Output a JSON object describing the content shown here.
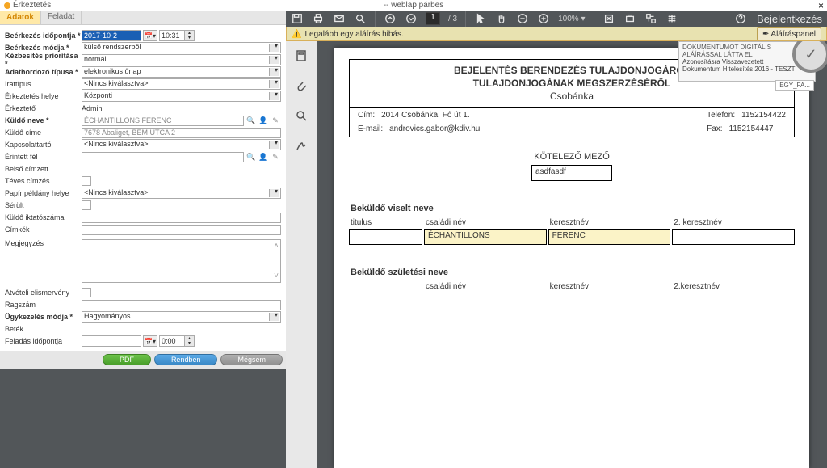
{
  "window": {
    "title": "Érkeztetés",
    "dialog": "-- weblap párbes"
  },
  "tabs": {
    "t1": "Adatok",
    "t2": "Feladat"
  },
  "form": {
    "l_arrive_time": "Beérkezés időpontja *",
    "v_arrive_date": "2017-10-2",
    "v_arrive_time": "10:31",
    "l_arrive_mode": "Beérkezés módja *",
    "v_arrive_mode": "külső rendszerből",
    "l_priority": "Kézbesítés prioritása *",
    "v_priority": "normál",
    "l_carrier": "Adathordozó típusa *",
    "v_carrier": "elektronikus űrlap",
    "l_doc_type": "Irattípus",
    "v_doc_type": "<Nincs kiválasztva>",
    "l_loc": "Érkeztetés helye",
    "v_loc": "Központi",
    "l_by": "Érkeztető",
    "v_by": "Admin",
    "l_sender": "Küldő neve *",
    "v_sender": "ÉCHANTILLONS FERENC",
    "l_sender_addr": "Küldő címe",
    "v_sender_addr": "7678 Abaliget, BEM UTCA 2",
    "l_contact": "Kapcsolattartó",
    "v_contact": "<Nincs kiválasztva>",
    "l_affected": "Érintett fél",
    "l_internal": "Belső címzett",
    "l_wrong": "Téves címzés",
    "l_paper": "Papír példány helye",
    "v_paper": "<Nincs kiválasztva>",
    "l_damaged": "Sérült",
    "l_sender_regnum": "Küldő iktatószáma",
    "l_tags": "Címkék",
    "l_note": "Megjegyzés",
    "l_ack": "Átvételi elismervény",
    "l_sticker": "Ragszám",
    "l_case": "Ügykezelés módja *",
    "v_case": "Hagyományos",
    "l_batch": "Beték",
    "l_sent": "Feladás időpontja",
    "v_sent_time": "0:00"
  },
  "buttons": {
    "pdf": "PDF",
    "ok": "Rendben",
    "cancel": "Mégsem"
  },
  "viewer": {
    "page": "1",
    "pages": "/ 3",
    "zoom": "100%",
    "login": "Bejelentkezés",
    "warn": "Legalább egy aláírás hibás.",
    "warn_btn": "Aláíráspanel"
  },
  "stamp": {
    "l1": "DOKUMENTUMOT DIGITÁLIS",
    "l2": "ALÁÍRÁSSAL LÁTTA EL",
    "l3": "Azonosításra Visszavezetett",
    "l4": "Dokumentum Hitelesítés 2016 - TESZT",
    "egy": "EGY_FA..."
  },
  "doc": {
    "head1": "BEJELENTÉS BERENDEZÉS TULAJDONJOGÁRÓL",
    "head2": "TULAJDONJOGÁNAK MEGSZERZÉSÉRŐL",
    "city": "Csobánka",
    "l_addr": "Cím:",
    "addr": "2014 Csobánka, Fő út 1.",
    "l_mail": "E-mail:",
    "mail": "androvics.gabor@kdiv.hu",
    "l_tel": "Telefon:",
    "tel": "1152154422",
    "l_fax": "Fax:",
    "fax": "1152154447",
    "mandatory_lbl": "KÖTELEZŐ MEZŐ",
    "mandatory_val": "asdfasdf",
    "sec1": "Beküldő viselt neve",
    "c_title": "titulus",
    "c_family": "családi név",
    "c_first": "keresztnév",
    "c_first2": "2. keresztnév",
    "v_family": "ÉCHANTILLONS",
    "v_first": "FERENC",
    "sec2": "Beküldő születési neve",
    "c_first2b": "2.keresztnév"
  }
}
